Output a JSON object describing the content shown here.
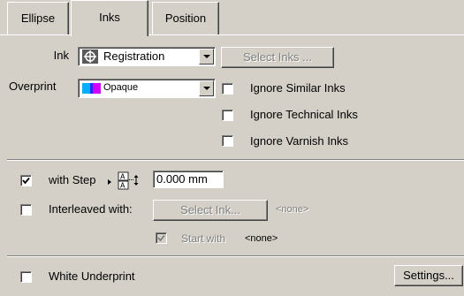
{
  "tabs": [
    {
      "label": "Ellipse"
    },
    {
      "label": "Inks"
    },
    {
      "label": "Position"
    }
  ],
  "active_tab": "Inks",
  "ink": {
    "label": "Ink",
    "value": "Registration",
    "icon": "registration-mark-icon",
    "select_button": "Select Inks ..."
  },
  "overprint": {
    "label": "Overprint",
    "value": "Opaque",
    "icon": "opaque-overprint-icon"
  },
  "options": {
    "ignore_similar": {
      "label": "Ignore Similar Inks",
      "checked": false
    },
    "ignore_technical": {
      "label": "Ignore Technical Inks",
      "checked": false
    },
    "ignore_varnish": {
      "label": "Ignore Varnish Inks",
      "checked": false
    }
  },
  "step": {
    "label": "with Step",
    "checked": true,
    "value": "0.000 mm",
    "step_icon": "step-offset-icon"
  },
  "interleaved": {
    "label": "Interleaved with:",
    "checked": false,
    "button": "Select Ink...",
    "value": "<none>"
  },
  "start_with": {
    "label": "Start with",
    "checked": true,
    "value": "<none>"
  },
  "white_underprint": {
    "label": "White Underprint",
    "checked": false,
    "settings_button": "Settings..."
  }
}
